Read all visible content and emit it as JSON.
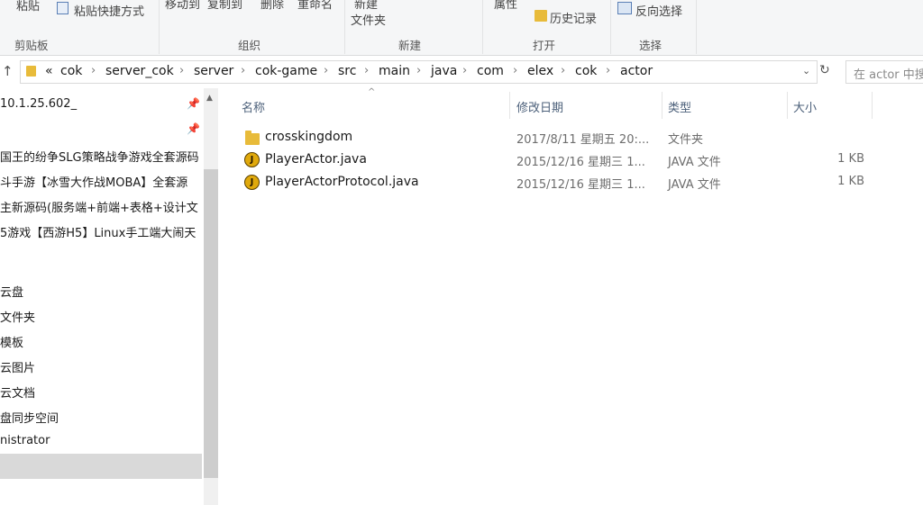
{
  "ribbon": {
    "clipboard_group": "剪贴板",
    "organize_group": "组织",
    "new_group": "新建",
    "open_group": "打开",
    "select_group": "选择",
    "paste_label": "粘贴",
    "paste_shortcut_label": "粘贴快捷方式",
    "move_to_label": "移动到",
    "copy_to_label": "复制到",
    "delete_label": "删除",
    "rename_label": "重命名",
    "new_label": "新建",
    "new_folder_label": "文件夹",
    "properties_label": "属性",
    "history_label": "历史记录",
    "invert_select_label": "反向选择"
  },
  "address": {
    "overflow": "«",
    "crumbs": [
      "cok",
      "server_cok",
      "server",
      "cok-game",
      "src",
      "main",
      "java",
      "com",
      "elex",
      "cok",
      "actor"
    ],
    "search_placeholder": "在 actor 中搜"
  },
  "nav": {
    "items": [
      "10.1.25.602_",
      "",
      "国王的纷争SLG策略战争游戏全套源码",
      "斗手游【冰雪大作战MOBA】全套源",
      "主新源码(服务端+前端+表格+设计文",
      "5游戏【西游H5】Linux手工端大闹天",
      "",
      "云盘",
      "文件夹",
      "模板",
      "云图片",
      "云文档",
      "盘同步空间",
      "nistrator"
    ]
  },
  "columns": {
    "name": "名称",
    "modified": "修改日期",
    "type": "类型",
    "size": "大小"
  },
  "files": [
    {
      "name": "crosskingdom",
      "modified": "2017/8/11 星期五 20:...",
      "type": "文件夹",
      "size": "",
      "icon": "folder-icon"
    },
    {
      "name": "PlayerActor.java",
      "modified": "2015/12/16 星期三 1...",
      "type": "JAVA 文件",
      "size": "1 KB",
      "icon": "java-file-icon"
    },
    {
      "name": "PlayerActorProtocol.java",
      "modified": "2015/12/16 星期三 1...",
      "type": "JAVA 文件",
      "size": "1 KB",
      "icon": "java-file-icon"
    }
  ],
  "colors": {
    "folder": "#e8bb3a",
    "header_text": "#4c607a"
  }
}
